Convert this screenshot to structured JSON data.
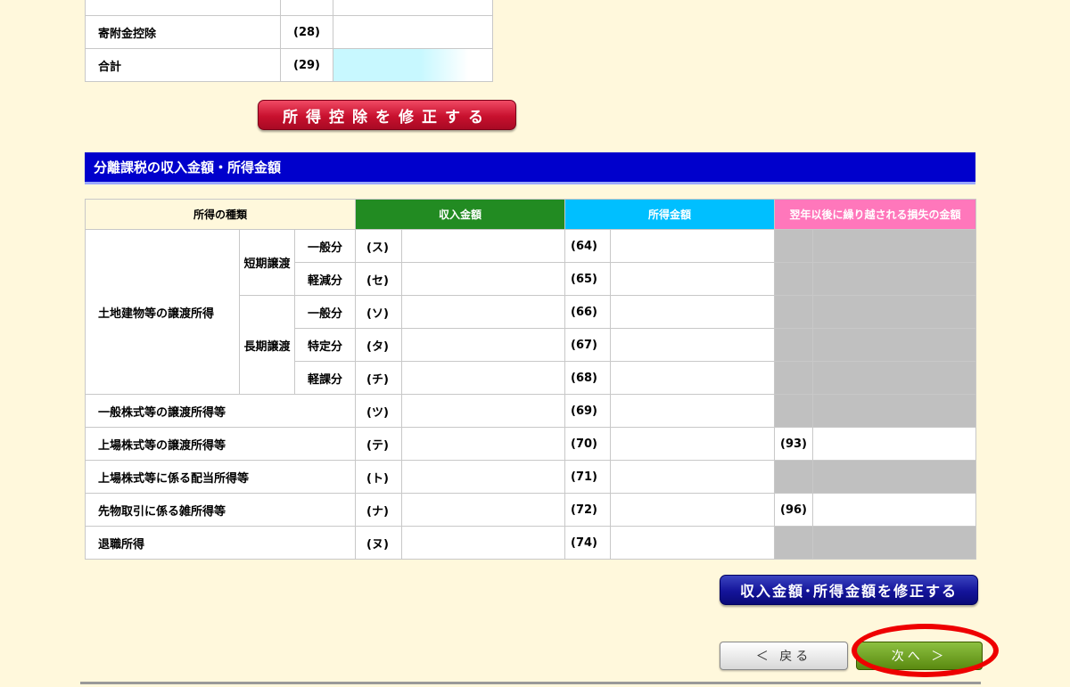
{
  "deduction_table": {
    "rows": [
      {
        "label": "",
        "code": "",
        "value": ""
      },
      {
        "label": "寄附金控除",
        "code": "(28)",
        "value": ""
      },
      {
        "label": "合計",
        "code": "(29)",
        "value": ""
      }
    ],
    "edit_button": "所得控除を修正する"
  },
  "separate_tax": {
    "title": "分離課税の収入金額・所得金額",
    "headers": {
      "kind": "所得の種類",
      "income": "収入金額",
      "shotoku": "所得金額",
      "loss": "翌年以後に繰り越される損失の金額"
    },
    "land_label": "土地建物等の譲渡所得",
    "short_term": "短期譲渡",
    "long_term": "長期譲渡",
    "rows": [
      {
        "sub": "一般分",
        "code": "(ス)",
        "num": "(64)",
        "loss": ""
      },
      {
        "sub": "軽減分",
        "code": "(セ)",
        "num": "(65)",
        "loss": ""
      },
      {
        "sub": "一般分",
        "code": "(ソ)",
        "num": "(66)",
        "loss": ""
      },
      {
        "sub": "特定分",
        "code": "(タ)",
        "num": "(67)",
        "loss": ""
      },
      {
        "sub": "軽課分",
        "code": "(チ)",
        "num": "(68)",
        "loss": ""
      },
      {
        "label": "一般株式等の譲渡所得等",
        "code": "(ツ)",
        "num": "(69)",
        "loss": ""
      },
      {
        "label": "上場株式等の譲渡所得等",
        "code": "(テ)",
        "num": "(70)",
        "loss": "(93)"
      },
      {
        "label": "上場株式等に係る配当所得等",
        "code": "(ト)",
        "num": "(71)",
        "loss": ""
      },
      {
        "label": "先物取引に係る雑所得等",
        "code": "(ナ)",
        "num": "(72)",
        "loss": "(96)"
      },
      {
        "label": "退職所得",
        "code": "(ヌ)",
        "num": "(74)",
        "loss": ""
      }
    ],
    "edit_button": "収入金額･所得金額を修正する"
  },
  "nav": {
    "back": "＜ 戻る",
    "next": "次へ ＞"
  },
  "colors": {
    "header_blue": "#0000cc",
    "income_green": "#228b22",
    "shotoku_cyan": "#00bfff",
    "loss_pink": "#ff77bb",
    "disabled_gray": "#c0c0c0",
    "annotation_red": "#ee0000"
  }
}
